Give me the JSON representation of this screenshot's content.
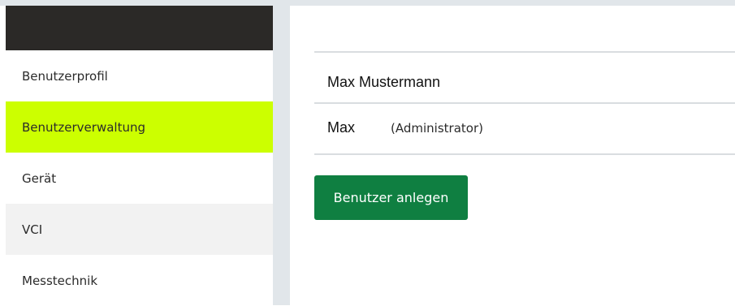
{
  "sidebar": {
    "items": [
      {
        "label": "Benutzerprofil"
      },
      {
        "label": "Benutzerverwaltung",
        "active": true
      },
      {
        "label": "Gerät"
      },
      {
        "label": "VCI"
      },
      {
        "label": "Messtechnik"
      }
    ]
  },
  "main": {
    "user": {
      "full_name": "Max Mustermann",
      "login": "Max",
      "role": "(Administrator)"
    },
    "create_button_label": "Benutzer anlegen"
  },
  "colors": {
    "sidebar_header": "#2b2927",
    "active_item": "#ccff00",
    "primary_button": "#0f7f41",
    "divider": "#e1e6ea"
  }
}
